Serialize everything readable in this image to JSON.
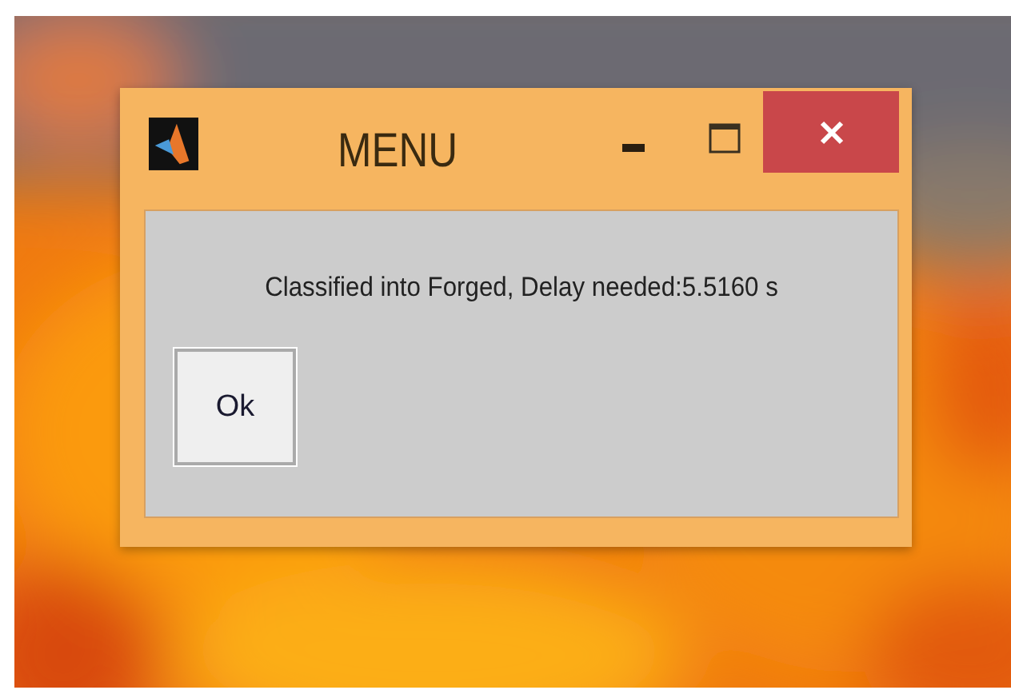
{
  "window": {
    "title": "MENU"
  },
  "message": "Classified into Forged, Delay needed:5.5160 s",
  "buttons": [
    "Ok"
  ]
}
